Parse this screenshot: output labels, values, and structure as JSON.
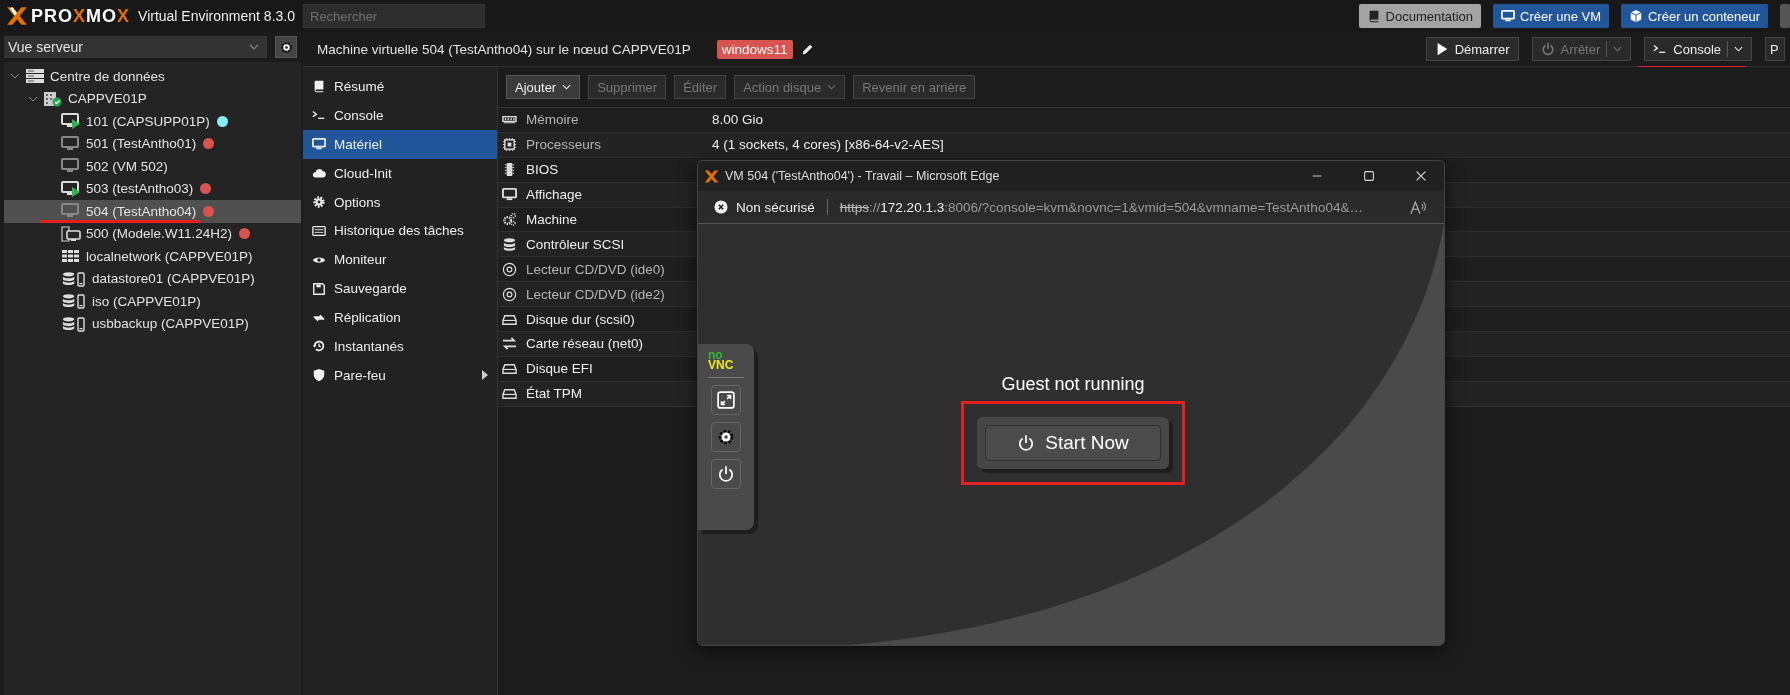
{
  "topbar": {
    "logo": [
      {
        "text": "PRO",
        "accent": false
      },
      {
        "text": "X",
        "accent": true
      },
      {
        "text": "MO",
        "accent": false
      },
      {
        "text": "X",
        "accent": true
      }
    ],
    "product": "Virtual Environment 8.3.0",
    "search": {
      "placeholder": "Rechercher"
    },
    "buttons": [
      {
        "label": "Documentation",
        "kind": "doc"
      },
      {
        "label": "Créer une VM",
        "kind": "vm"
      },
      {
        "label": "Créer un conteneur",
        "kind": "ct"
      }
    ]
  },
  "view_selector": {
    "value": "Vue serveur"
  },
  "tree": [
    {
      "label": "Centre de données",
      "kind": "datacenter",
      "expanded": true,
      "selected": false,
      "marked": false,
      "children": [
        {
          "label": "CAPPVE01P",
          "kind": "node",
          "expanded": true,
          "selected": false,
          "marked": false,
          "children": [
            {
              "label": "101 (CAPSUPP01P)",
              "kind": "vm-running",
              "selected": false,
              "marked": false,
              "color": "#80eef4"
            },
            {
              "label": "501 (TestAntho01)",
              "kind": "vm",
              "selected": false,
              "marked": false,
              "color": "#d9534f"
            },
            {
              "label": "502 (VM 502)",
              "kind": "vm",
              "selected": false,
              "marked": false
            },
            {
              "label": "503 (testAntho03)",
              "kind": "vm-running",
              "selected": false,
              "marked": false,
              "color": "#d9534f"
            },
            {
              "label": "504 (TestAntho04)",
              "kind": "vm",
              "selected": true,
              "marked": true,
              "color": "#d9534f"
            },
            {
              "label": "500 (Modele.W11.24H2)",
              "kind": "template",
              "selected": false,
              "marked": false,
              "color": "#d9534f"
            },
            {
              "label": "localnetwork (CAPPVE01P)",
              "kind": "sdn",
              "selected": false,
              "marked": false
            },
            {
              "label": "datastore01 (CAPPVE01P)",
              "kind": "storage",
              "selected": false,
              "marked": false
            },
            {
              "label": "iso (CAPPVE01P)",
              "kind": "storage",
              "selected": false,
              "marked": false
            },
            {
              "label": "usbbackup (CAPPVE01P)",
              "kind": "storage",
              "selected": false,
              "marked": false
            }
          ]
        }
      ]
    }
  ],
  "header": {
    "title": "Machine virtuelle 504 (TestAntho04) sur le nœud CAPPVE01P",
    "tag": "windows11",
    "buttons": [
      {
        "label": "Démarrer",
        "kind": "start",
        "disabled": false,
        "dropdown": false,
        "marked": false
      },
      {
        "label": "Arrêter",
        "kind": "stop",
        "disabled": true,
        "dropdown": true,
        "marked": false
      },
      {
        "label": "Console",
        "kind": "console",
        "disabled": false,
        "dropdown": true,
        "marked": true
      },
      {
        "label": "P",
        "kind": "more",
        "disabled": false,
        "dropdown": false,
        "marked": false
      }
    ]
  },
  "menu": [
    {
      "label": "Résumé",
      "kind": "summary",
      "selected": false,
      "submenu": false
    },
    {
      "label": "Console",
      "kind": "console",
      "selected": false,
      "submenu": false
    },
    {
      "label": "Matériel",
      "kind": "hardware",
      "selected": true,
      "submenu": false
    },
    {
      "label": "Cloud-Init",
      "kind": "cloud",
      "selected": false,
      "submenu": false
    },
    {
      "label": "Options",
      "kind": "gear",
      "selected": false,
      "submenu": false
    },
    {
      "label": "Historique des tâches",
      "kind": "list",
      "selected": false,
      "submenu": false
    },
    {
      "label": "Moniteur",
      "kind": "eye",
      "selected": false,
      "submenu": false
    },
    {
      "label": "Sauvegarde",
      "kind": "floppy",
      "selected": false,
      "submenu": false
    },
    {
      "label": "Réplication",
      "kind": "replication",
      "selected": false,
      "submenu": false
    },
    {
      "label": "Instantanés",
      "kind": "history",
      "selected": false,
      "submenu": false
    },
    {
      "label": "Pare-feu",
      "kind": "shield",
      "selected": false,
      "submenu": true
    }
  ],
  "toolbar": [
    {
      "label": "Ajouter",
      "disabled": false,
      "dropdown": true
    },
    {
      "label": "Supprimer",
      "disabled": true,
      "dropdown": false
    },
    {
      "label": "Éditer",
      "disabled": true,
      "dropdown": false
    },
    {
      "label": "Action disque",
      "disabled": true,
      "dropdown": true
    },
    {
      "label": "Revenir en arrière",
      "disabled": true,
      "dropdown": false
    }
  ],
  "hardware": [
    {
      "name": "Mémoire",
      "kind": "memory",
      "dim": true,
      "value": "8.00 Gio"
    },
    {
      "name": "Processeurs",
      "kind": "cpu",
      "dim": true,
      "value": "4 (1 sockets, 4 cores) [x86-64-v2-AES]"
    },
    {
      "name": "BIOS",
      "kind": "bios",
      "dim": false
    },
    {
      "name": "Affichage",
      "kind": "display",
      "dim": false
    },
    {
      "name": "Machine",
      "kind": "machine",
      "dim": false
    },
    {
      "name": "Contrôleur SCSI",
      "kind": "db",
      "dim": false
    },
    {
      "name": "Lecteur CD/DVD (ide0)",
      "kind": "cd",
      "dim": true
    },
    {
      "name": "Lecteur CD/DVD (ide2)",
      "kind": "cd",
      "dim": true
    },
    {
      "name": "Disque dur (scsi0)",
      "kind": "hdd",
      "dim": false
    },
    {
      "name": "Carte réseau (net0)",
      "kind": "net",
      "dim": false
    },
    {
      "name": "Disque EFI",
      "kind": "hdd",
      "dim": false
    },
    {
      "name": "État TPM",
      "kind": "hdd",
      "dim": false
    }
  ],
  "popup": {
    "title": "VM 504 ('TestAntho04') - Travail – Microsoft Edge",
    "security": "Non sécurisé",
    "url": [
      {
        "text": "https",
        "kind": "insecure"
      },
      {
        "text": "://",
        "kind": "dim"
      },
      {
        "text": "172.20.1.3",
        "kind": "host"
      },
      {
        "text": ":8006/?console=kvm&novnc=1&vmid=504&vmname=TestAntho04&…",
        "kind": "dim"
      }
    ],
    "novnc_logo": [
      "no",
      "VNC"
    ],
    "message": "Guest not running",
    "start_button": {
      "label": "Start Now",
      "marked": true
    }
  }
}
